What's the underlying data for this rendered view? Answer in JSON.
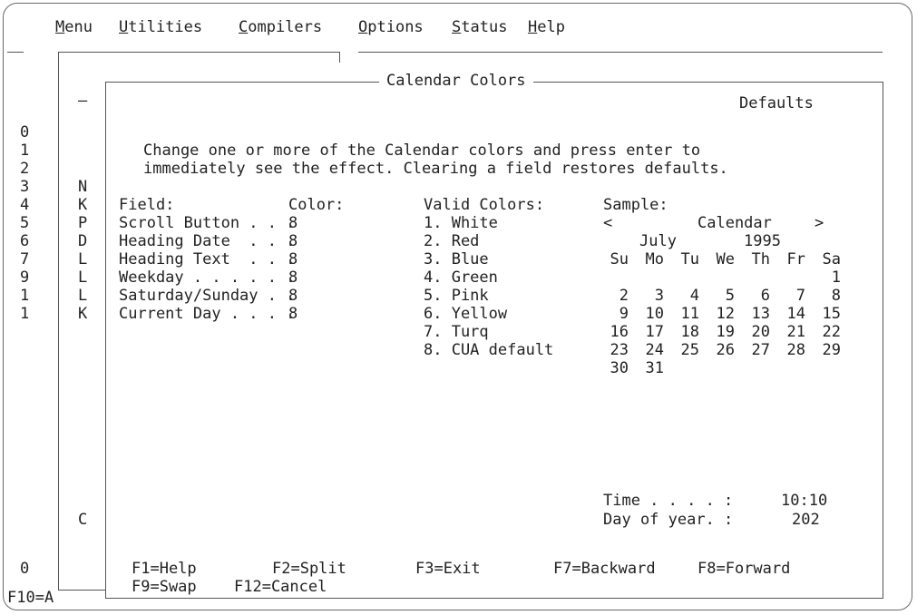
{
  "menubar": {
    "items": [
      "Menu",
      "Utilities",
      "Compilers",
      "Options",
      "Status",
      "Help"
    ]
  },
  "background": {
    "dash_left": "—",
    "dash_inner": "—",
    "left_digits": [
      "0",
      "1",
      "2",
      "3",
      "4",
      "5",
      "6",
      "7",
      "9",
      "1",
      "1"
    ],
    "left_letters": [
      "N",
      "K",
      "P",
      "D",
      "L",
      "L",
      "L",
      "K"
    ],
    "letter_c": "C",
    "digit_zero": "0",
    "bottom_key": "F10=A"
  },
  "dialog": {
    "title": "Calendar Colors",
    "defaults_label": "Defaults",
    "instructions": [
      "Change one or more of the Calendar colors and press enter to",
      "immediately see the effect. Clearing a field restores defaults."
    ],
    "field_header": "Field:",
    "color_header": "Color:",
    "fields": [
      {
        "label": "Scroll Button . . .",
        "value": "8"
      },
      {
        "label": "Heading Date  . . .",
        "value": "8"
      },
      {
        "label": "Heading Text  . . .",
        "value": "8"
      },
      {
        "label": "Weekday . . . . . .",
        "value": "8"
      },
      {
        "label": "Saturday/Sunday . .",
        "value": "8"
      },
      {
        "label": "Current Day . . . .",
        "value": "8"
      }
    ],
    "valid_colors_header": "Valid Colors:",
    "valid_colors": [
      "1. White",
      "2. Red",
      "3. Blue",
      "4. Green",
      "5. Pink",
      "6. Yellow",
      "7. Turq",
      "8. CUA default"
    ],
    "sample": {
      "header": "Sample:",
      "prev": "<",
      "calendar_label": "Calendar",
      "next": ">",
      "month": "July",
      "year": "1995",
      "weekdays": [
        "Su",
        "Mo",
        "Tu",
        "We",
        "Th",
        "Fr",
        "Sa"
      ],
      "weeks": [
        [
          "",
          "",
          "",
          "",
          "",
          "",
          "1"
        ],
        [
          "2",
          "3",
          "4",
          "5",
          "6",
          "7",
          "8"
        ],
        [
          "9",
          "10",
          "11",
          "12",
          "13",
          "14",
          "15"
        ],
        [
          "16",
          "17",
          "18",
          "19",
          "20",
          "21",
          "22"
        ],
        [
          "23",
          "24",
          "25",
          "26",
          "27",
          "28",
          "29"
        ],
        [
          "30",
          "31",
          "",
          "",
          "",
          "",
          ""
        ]
      ],
      "time_label": "Time . . . . :",
      "time_value": "10:10",
      "day_label": "Day of year. :",
      "day_value": "202"
    },
    "function_keys": [
      [
        "F1=Help",
        "F2=Split",
        "F3=Exit",
        "F7=Backward",
        "F8=Forward"
      ],
      [
        "F9=Swap",
        "F12=Cancel"
      ]
    ]
  }
}
